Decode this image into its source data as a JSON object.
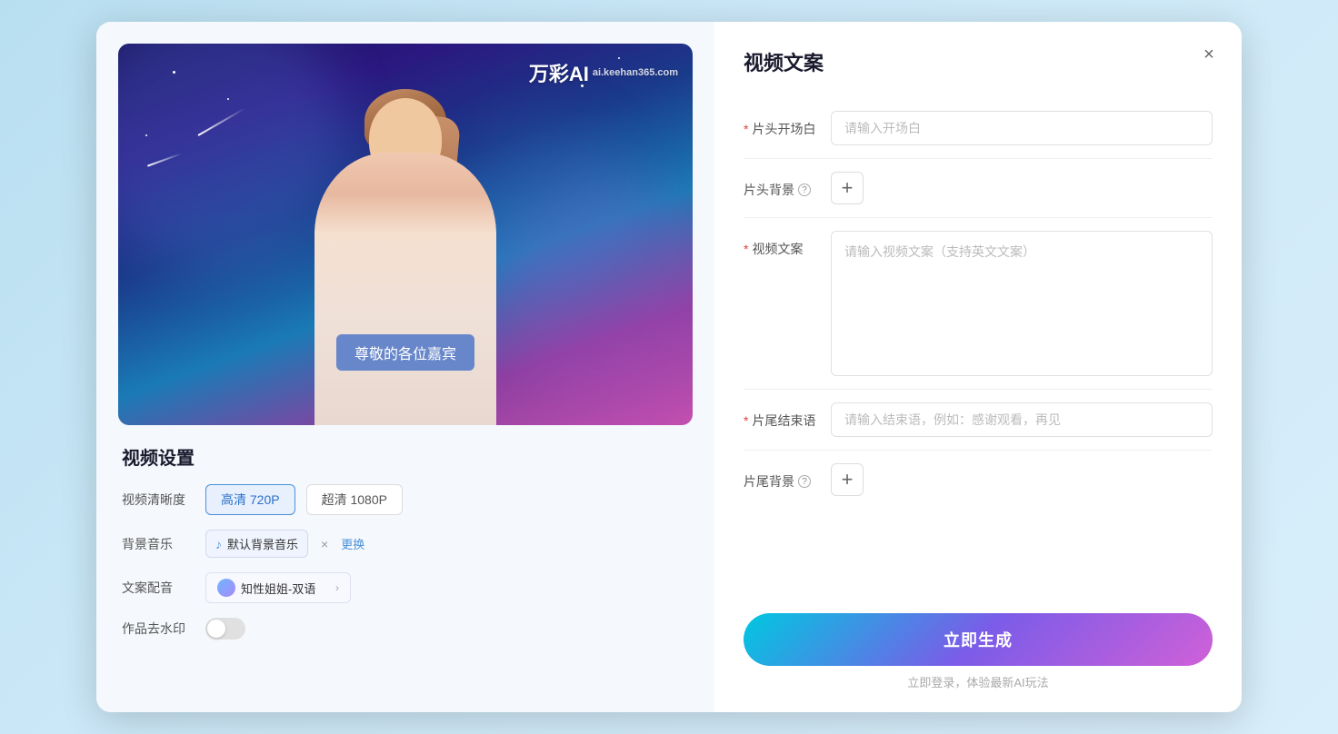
{
  "modal": {
    "close_label": "×"
  },
  "right_panel": {
    "title": "视频文案",
    "fields": {
      "opening": {
        "label": "片头开场白",
        "required": true,
        "placeholder": "请输入开场白"
      },
      "header_bg": {
        "label": "片头背景",
        "required": false
      },
      "video_copy": {
        "label": "视频文案",
        "required": true,
        "placeholder": "请输入视频文案（支持英文文案）"
      },
      "ending": {
        "label": "片尾结束语",
        "required": true,
        "placeholder": "请输入结束语，例如：感谢观看，再见"
      },
      "tail_bg": {
        "label": "片尾背景",
        "required": false
      }
    },
    "generate_btn": "立即生成",
    "login_hint": "立即登录，体验最新AI玩法"
  },
  "left_panel": {
    "preview": {
      "watermark_brand": "万彩AI",
      "watermark_site": "ai.keehan365.com",
      "subtitle": "尊敬的各位嘉宾"
    },
    "settings": {
      "title": "视频设置",
      "quality_label": "视频清晰度",
      "quality_options": [
        "高清 720P",
        "超清 1080P"
      ],
      "quality_active": 0,
      "music_label": "背景音乐",
      "music_default": "默认背景音乐",
      "music_change": "更换",
      "voice_label": "文案配音",
      "voice_name": "知性姐姐-双语",
      "watermark_label": "作品去水印"
    }
  }
}
